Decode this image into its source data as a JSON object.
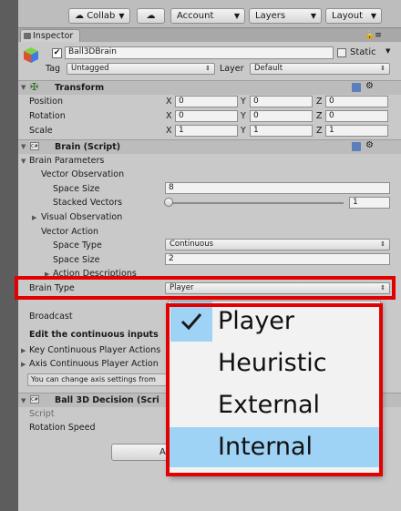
{
  "toolbar": {
    "collab_label": "Collab",
    "account_label": "Account",
    "layers_label": "Layers",
    "layout_label": "Layout"
  },
  "tab": {
    "label": "Inspector"
  },
  "object": {
    "name": "Ball3DBrain",
    "static_label": "Static",
    "tag_label": "Tag",
    "tag_value": "Untagged",
    "layer_label": "Layer",
    "layer_value": "Default"
  },
  "transform": {
    "title": "Transform",
    "rows": [
      {
        "label": "Position",
        "x": "0",
        "y": "0",
        "z": "0"
      },
      {
        "label": "Rotation",
        "x": "0",
        "y": "0",
        "z": "0"
      },
      {
        "label": "Scale",
        "x": "1",
        "y": "1",
        "z": "1"
      }
    ],
    "axis_labels": {
      "x": "X",
      "y": "Y",
      "z": "Z"
    }
  },
  "brain": {
    "title": "Brain (Script)",
    "params_label": "Brain Parameters",
    "vector_observation": "Vector Observation",
    "space_size_label": "Space Size",
    "space_size_value": "8",
    "stacked_vectors_label": "Stacked Vectors",
    "stacked_vectors_value": "1",
    "stacked_vectors_fraction": 0.0,
    "visual_observation": "Visual Observation",
    "vector_action": "Vector Action",
    "space_type_label": "Space Type",
    "space_type_value": "Continuous",
    "action_space_size_label": "Space Size",
    "action_space_size_value": "2",
    "action_descriptions": "Action Descriptions",
    "brain_type_label": "Brain Type",
    "brain_type_value": "Player",
    "broadcast_label": "Broadcast",
    "edit_continuous": "Edit the continuous inputs",
    "key_continuous": "Key Continuous Player Actions",
    "axis_continuous": "Axis Continuous Player Action",
    "help_text": "You can change axis settings from"
  },
  "decision": {
    "title": "Ball 3D Decision (Scri",
    "script_label": "Script",
    "rotation_speed_label": "Rotation Speed",
    "button_partial": "A"
  },
  "dropdown": {
    "options": [
      "Player",
      "Heuristic",
      "External",
      "Internal"
    ],
    "checked_index": 0,
    "highlighted_index": 3
  },
  "colors": {
    "highlight_border": "#e20000",
    "selection": "#9fd3f5"
  }
}
